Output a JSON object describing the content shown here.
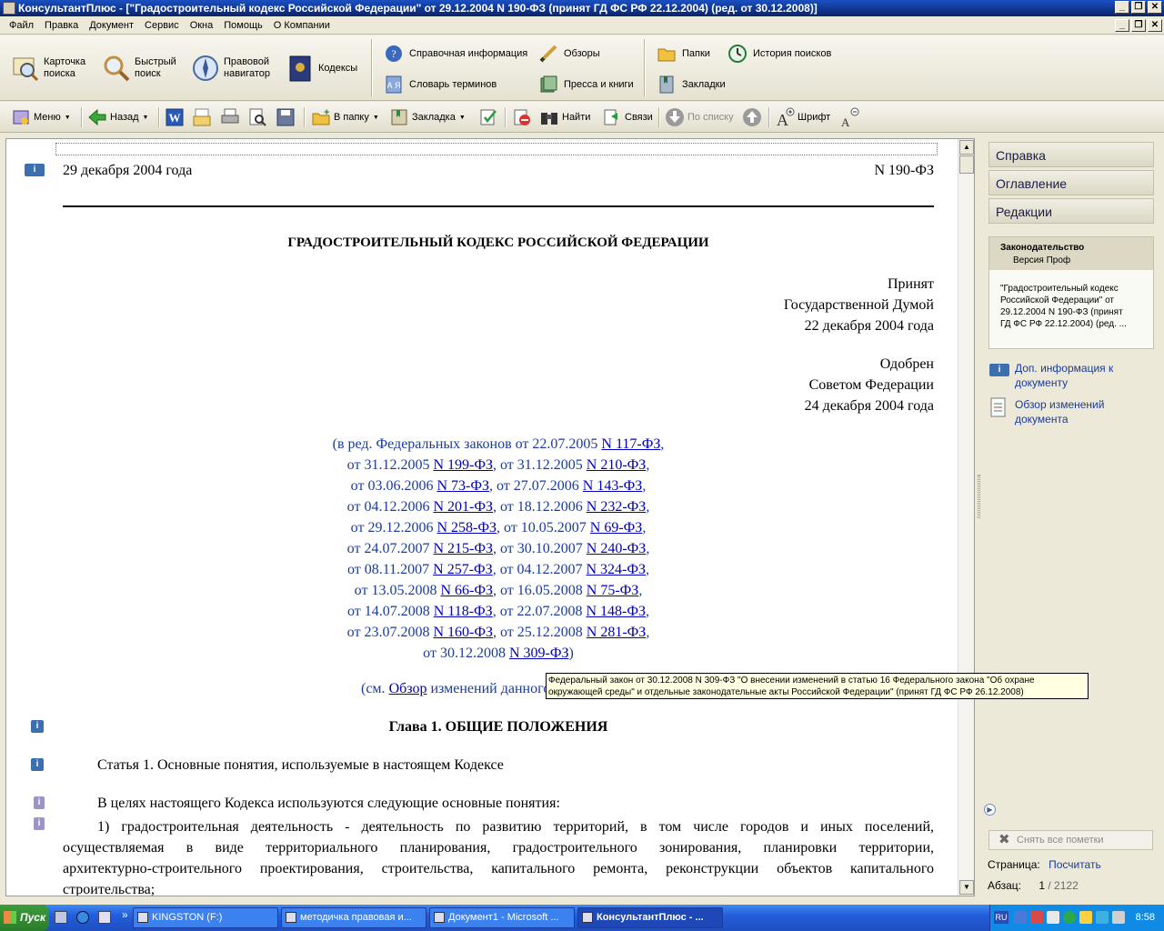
{
  "window": {
    "title": "КонсультантПлюс - [\"Градостроительный кодекс Российской Федерации\" от 29.12.2004 N 190-ФЗ (принят ГД ФС РФ 22.12.2004) (ред. от 30.12.2008)]",
    "min": "_",
    "restore": "❐",
    "close": "✕"
  },
  "menu": {
    "items": [
      "Файл",
      "Правка",
      "Документ",
      "Сервис",
      "Окна",
      "Помощь",
      "О Компании"
    ]
  },
  "bigbar": {
    "card_search": "Карточка поиска",
    "quick_search": "Быстрый поиск",
    "legal_navigator": "Правовой навигатор",
    "codes": "Кодексы",
    "reference_info": "Справочная информация",
    "reviews": "Обзоры",
    "glossary": "Словарь терминов",
    "press_books": "Пресса и книги",
    "folders": "Папки",
    "search_history": "История поисков",
    "bookmarks": "Закладки"
  },
  "toolbar": {
    "menu": "Меню",
    "back": "Назад",
    "to_folder": "В папку",
    "bookmark": "Закладка",
    "find": "Найти",
    "links": "Связи",
    "by_list": "По списку",
    "font": "Шрифт"
  },
  "doc": {
    "date": "29 декабря 2004 года",
    "number": "N 190-ФЗ",
    "title": "ГРАДОСТРОИТЕЛЬНЫЙ КОДЕКС РОССИЙСКОЙ ФЕДЕРАЦИИ",
    "adopted": [
      "Принят",
      "Государственной Думой",
      "22 декабря 2004 года"
    ],
    "approved": [
      "Одобрен",
      "Советом Федерации",
      "24 декабря 2004 года"
    ],
    "amend_lines": [
      {
        "pre": "(в ред. Федеральных законов от 22.07.2005 ",
        "l1": "N 117-ФЗ",
        "mid": "",
        "l2": "",
        "post": ","
      },
      {
        "pre": "от 31.12.2005 ",
        "l1": "N 199-ФЗ",
        "mid": ", от 31.12.2005 ",
        "l2": "N 210-ФЗ",
        "post": ","
      },
      {
        "pre": "от 03.06.2006 ",
        "l1": "N 73-ФЗ",
        "mid": ", от 27.07.2006 ",
        "l2": "N 143-ФЗ",
        "post": ","
      },
      {
        "pre": "от 04.12.2006 ",
        "l1": "N 201-ФЗ",
        "mid": ", от 18.12.2006 ",
        "l2": "N 232-ФЗ",
        "post": ","
      },
      {
        "pre": "от 29.12.2006 ",
        "l1": "N 258-ФЗ",
        "mid": ", от 10.05.2007 ",
        "l2": "N 69-ФЗ",
        "post": ","
      },
      {
        "pre": "от 24.07.2007 ",
        "l1": "N 215-ФЗ",
        "mid": ", от 30.10.2007 ",
        "l2": "N 240-ФЗ",
        "post": ","
      },
      {
        "pre": "от 08.11.2007 ",
        "l1": "N 257-ФЗ",
        "mid": ", от 04.12.2007 ",
        "l2": "N 324-ФЗ",
        "post": ","
      },
      {
        "pre": "от 13.05.2008 ",
        "l1": "N 66-ФЗ",
        "mid": ", от 16.05.2008 ",
        "l2": "N 75-ФЗ",
        "post": ","
      },
      {
        "pre": "от 14.07.2008 ",
        "l1": "N 118-ФЗ",
        "mid": ", от 22.07.2008 ",
        "l2": "N 148-ФЗ",
        "post": ","
      },
      {
        "pre": "от 23.07.2008 ",
        "l1": "N 160-ФЗ",
        "mid": ", от 25.12.2008 ",
        "l2": "N 281-ФЗ",
        "post": ","
      },
      {
        "pre": "от 30.12.2008 ",
        "l1": "N 309-ФЗ",
        "mid": "",
        "l2": "",
        "post": ")"
      }
    ],
    "see_pre": "(см. ",
    "see_link": "Обзор",
    "see_post": " изменений данного",
    "chapter": "Глава 1. ОБЩИЕ ПОЛОЖЕНИЯ",
    "article": "Статья 1. Основные понятия, используемые в настоящем Кодексе",
    "para1": "В целях настоящего Кодекса используются следующие основные понятия:",
    "para2": [
      "1) градостроительная деятельность - деятельность по развитию территорий, в том числе городов и иных поселений,",
      "осуществляемая в виде территориального планирования, градостроительного зонирования, планировки территории,",
      "архитектурно-строительного проектирования, строительства, капитального ремонта, реконструкции объектов капитального",
      "строительства;"
    ],
    "info": "i"
  },
  "tooltip": {
    "line1": "Федеральный закон от 30.12.2008 N 309-ФЗ \"О внесении изменений в статью 16 Федерального закона \"Об охране",
    "line2": "окружающей среды\" и отдельные законодательные акты Российской Федерации\" (принят ГД ФС РФ 26.12.2008)"
  },
  "right_panel": {
    "tabs": [
      "Справка",
      "Оглавление",
      "Редакции"
    ],
    "box_head1": "Законодательство",
    "box_head2": "Версия Проф",
    "box_text": [
      "\"Градостроительный кодекс",
      "Российской Федерации\" от",
      "29.12.2004 N 190-ФЗ (принят",
      "ГД ФС РФ 22.12.2004) (ред. ..."
    ],
    "link1": [
      "Доп. информация к",
      "документу"
    ],
    "link2": [
      "Обзор изменений",
      "документа"
    ],
    "clear_marks": "Снять все пометки",
    "page_label": "Страница:",
    "page_link": "Посчитать",
    "para_label": "Абзац:",
    "para_value": "1",
    "para_total": "/ 2122"
  },
  "taskbar": {
    "start": "Пуск",
    "tasks": [
      "KINGSTON (F:)",
      "методичка правовая и...",
      "Документ1 - Microsoft ...",
      "КонсультантПлюс - ..."
    ],
    "lang": "RU",
    "clock": "8:58"
  }
}
